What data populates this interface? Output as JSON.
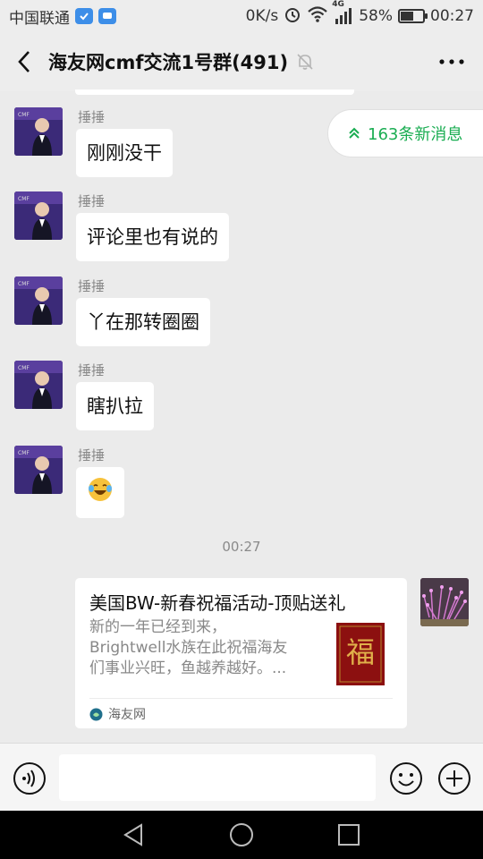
{
  "status_bar": {
    "carrier": "中国联通",
    "speed": "0K/s",
    "network": "4G",
    "battery": "58%",
    "battery_level": 0.58,
    "time": "00:27"
  },
  "header": {
    "title": "海友网cmf交流1号群(491)"
  },
  "new_messages": {
    "label": "163条新消息"
  },
  "messages": [
    {
      "sender": "捶捶",
      "text": "刚刚没干"
    },
    {
      "sender": "捶捶",
      "text": "评论里也有说的"
    },
    {
      "sender": "捶捶",
      "text": "丫在那转圈圈"
    },
    {
      "sender": "捶捶",
      "text": "瞎扒拉"
    },
    {
      "sender": "捶捶",
      "text": "",
      "emoji": "laughing-crying-emoji"
    }
  ],
  "time_divider": "00:27",
  "link_card": {
    "title": "美国BW-新春祝福活动-顶贴送礼",
    "desc_lines": [
      "新的一年已经到来，",
      "Brightwell水族在此祝福海友",
      "们事业兴旺，鱼越养越好。..."
    ],
    "thumb_text": "福",
    "source": "海友网"
  },
  "input": {
    "placeholder": ""
  },
  "colors": {
    "accent_green": "#1aad52",
    "background": "#ebebeb"
  }
}
